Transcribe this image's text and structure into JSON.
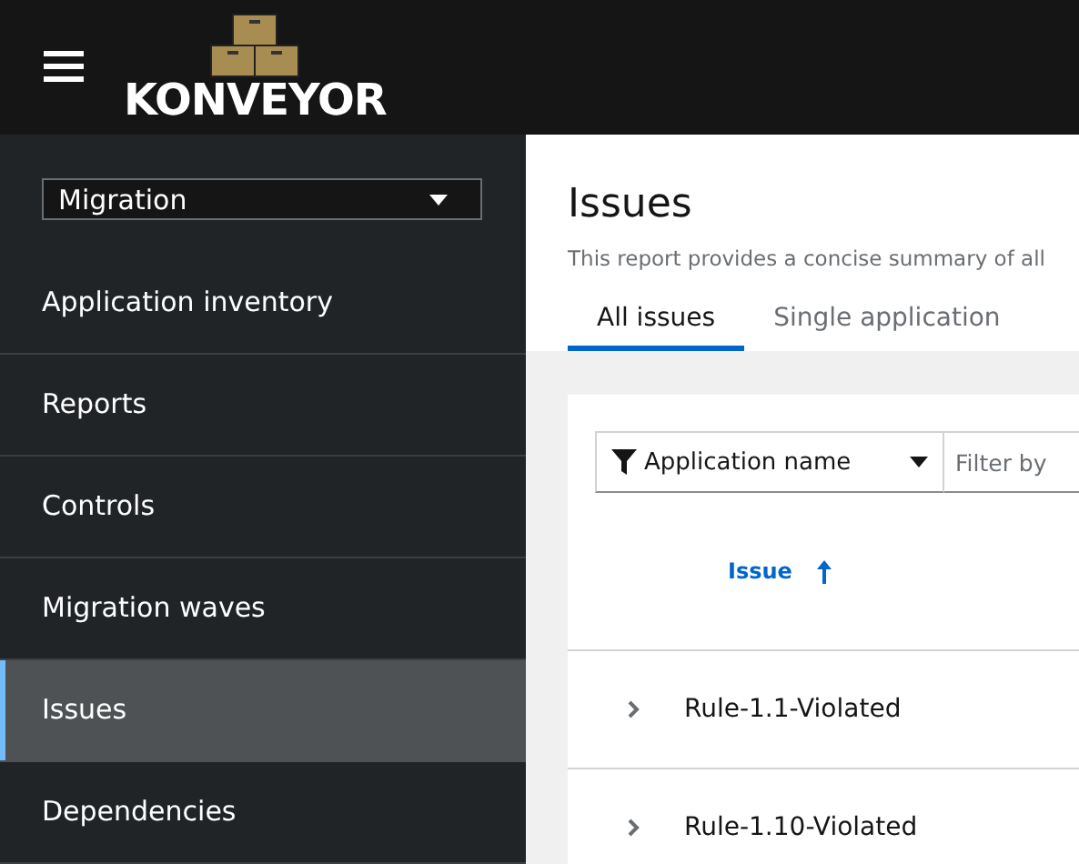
{
  "header": {
    "brand": "KONVEYOR"
  },
  "sidebar": {
    "perspective": "Migration",
    "items": [
      {
        "label": "Application inventory",
        "selected": false
      },
      {
        "label": "Reports",
        "selected": false
      },
      {
        "label": "Controls",
        "selected": false
      },
      {
        "label": "Migration waves",
        "selected": false
      },
      {
        "label": "Issues",
        "selected": true
      },
      {
        "label": "Dependencies",
        "selected": false
      }
    ]
  },
  "page": {
    "title": "Issues",
    "description": "This report provides a concise summary of all",
    "tabs": [
      {
        "label": "All issues",
        "selected": true
      },
      {
        "label": "Single application",
        "selected": false
      }
    ]
  },
  "toolbar": {
    "filter_category": "Application name",
    "filter_placeholder": "Filter by"
  },
  "table": {
    "columns": [
      {
        "label": "Issue",
        "sorted": true
      }
    ],
    "rows": [
      {
        "name": "Rule-1.1-Violated",
        "expanded": false
      },
      {
        "name": "Rule-1.10-Violated",
        "expanded": false
      }
    ]
  }
}
